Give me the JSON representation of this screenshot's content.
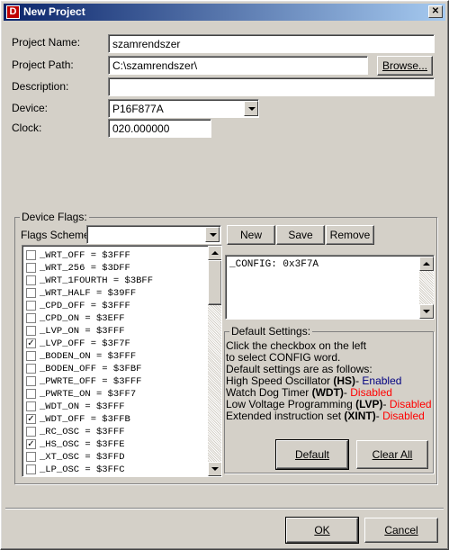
{
  "window": {
    "title": "New Project",
    "app_icon_letter": "D",
    "close_glyph": "✕"
  },
  "form": {
    "project_name_label": "Project Name:",
    "project_name_value": "szamrendszer",
    "project_path_label": "Project Path:",
    "project_path_value": "C:\\szamrendszer\\",
    "browse_label": "Browse...",
    "description_label": "Description:",
    "description_value": "",
    "device_label": "Device:",
    "device_value": "P16F877A",
    "clock_label": "Clock:",
    "clock_value": "020.000000"
  },
  "device_flags": {
    "group_title": "Device Flags:",
    "flags_scheme_label": "Flags Scheme:",
    "flags_scheme_value": "",
    "new_label": "New",
    "save_label": "Save",
    "remove_label": "Remove",
    "flags": [
      {
        "text": "_WRT_OFF = $3FFF",
        "checked": false
      },
      {
        "text": "_WRT_256 = $3DFF",
        "checked": false
      },
      {
        "text": "_WRT_1FOURTH = $3BFF",
        "checked": false
      },
      {
        "text": "_WRT_HALF = $39FF",
        "checked": false
      },
      {
        "text": "_CPD_OFF = $3FFF",
        "checked": false
      },
      {
        "text": "_CPD_ON = $3EFF",
        "checked": false
      },
      {
        "text": "_LVP_ON = $3FFF",
        "checked": false
      },
      {
        "text": "_LVP_OFF = $3F7F",
        "checked": true
      },
      {
        "text": "_BODEN_ON = $3FFF",
        "checked": false
      },
      {
        "text": "_BODEN_OFF = $3FBF",
        "checked": false
      },
      {
        "text": "_PWRTE_OFF = $3FFF",
        "checked": false
      },
      {
        "text": "_PWRTE_ON = $3FF7",
        "checked": false
      },
      {
        "text": "_WDT_ON = $3FFF",
        "checked": false
      },
      {
        "text": "_WDT_OFF = $3FFB",
        "checked": true
      },
      {
        "text": "_RC_OSC = $3FFF",
        "checked": false
      },
      {
        "text": "_HS_OSC = $3FFE",
        "checked": true
      },
      {
        "text": "_XT_OSC = $3FFD",
        "checked": false
      },
      {
        "text": "_LP_OSC = $3FFC",
        "checked": false
      }
    ],
    "check_glyph": "✓",
    "config_text": "_CONFIG: 0x3F7A"
  },
  "defaults": {
    "group_title": "Default Settings:",
    "line1": "Click the checkbox on the left",
    "line2": "to select CONFIG word.",
    "line3": "Default settings are as follows:",
    "hs_prefix": "High Speed Oscillator ",
    "hs_abbr": "(HS)",
    "hs_sep": "- ",
    "hs_status": "Enabled",
    "wdt_prefix": "Watch Dog Timer ",
    "wdt_abbr": "(WDT)",
    "wdt_sep": "- ",
    "wdt_status": "Disabled",
    "lvp_prefix": "Low Voltage Programming ",
    "lvp_abbr": "(LVP)",
    "lvp_sep": "- ",
    "lvp_status": "Disabled",
    "xint_prefix": "Extended instruction set ",
    "xint_abbr": "(XINT)",
    "xint_sep": "- ",
    "xint_status": "Disabled",
    "default_label": "Default",
    "clear_all_label": "Clear All"
  },
  "footer": {
    "ok_label": "OK",
    "cancel_label": "Cancel"
  },
  "colors": {
    "titlebar": "#0a246a",
    "face": "#d4d0c8",
    "enabled": "#000080",
    "disabled": "#ff0000"
  }
}
